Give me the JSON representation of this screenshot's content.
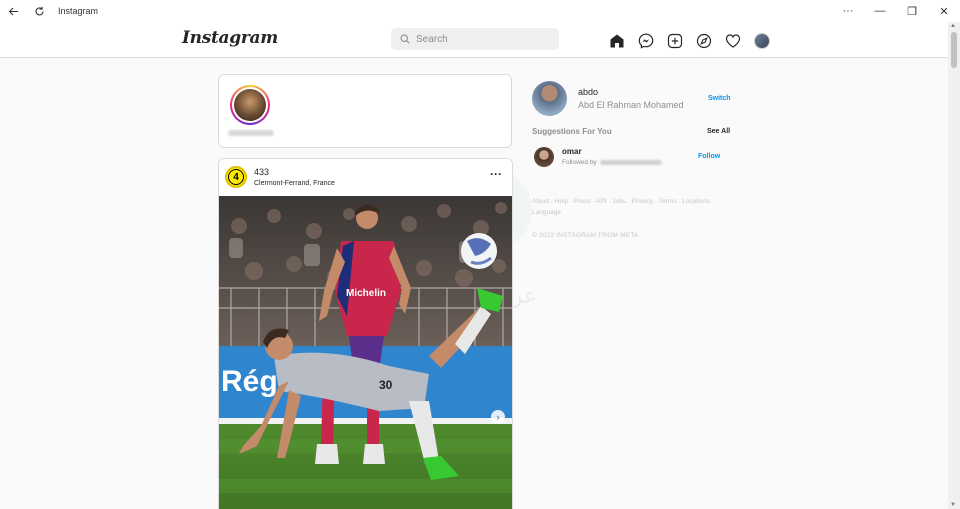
{
  "window": {
    "title": "Instagram",
    "more_glyph": "···",
    "minimize_glyph": "—",
    "maximize_glyph": "❐",
    "close_glyph": "✕"
  },
  "header": {
    "logo": "Instagram",
    "search": {
      "placeholder": "Search",
      "value": ""
    },
    "nav_icons": [
      "home-icon",
      "messenger-icon",
      "new-post-icon",
      "explore-icon",
      "heart-icon",
      "profile-avatar"
    ]
  },
  "post": {
    "username": "433",
    "avatar_badge": "4",
    "location": "Clermont-Ferrand, France",
    "more_glyph": "···",
    "next_glyph": "›",
    "jersey_number": "30",
    "sponsor": "Michelin",
    "banner_text": "Rég"
  },
  "sidebar": {
    "profile": {
      "username": "abdo",
      "full_name": "Abd El Rahman Mohamed",
      "switch_label": "Switch"
    },
    "suggestions_title": "Suggestions For You",
    "see_all_label": "See All",
    "suggestions": [
      {
        "username": "omar",
        "subtitle": "Followed by",
        "action": "Follow"
      }
    ],
    "footer_links": [
      "About",
      "Help",
      "Press",
      "API",
      "Jobs",
      "Privacy",
      "Terms",
      "Locations",
      "Language"
    ],
    "copyright": "© 2022 INSTAGRAM FROM META"
  },
  "watermark_text": "عر",
  "colors": {
    "link_blue": "#0095f6",
    "muted_text": "#8e8e8e",
    "border": "#dbdbdb",
    "background": "#fafafa"
  }
}
